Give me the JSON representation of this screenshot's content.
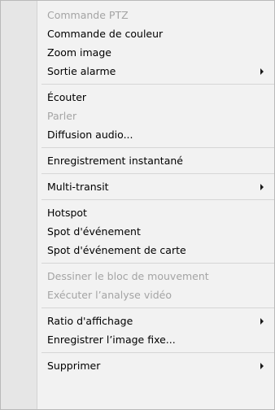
{
  "menu": {
    "items": [
      {
        "type": "item",
        "label": "Commande PTZ",
        "disabled": true,
        "submenu": false
      },
      {
        "type": "item",
        "label": "Commande de couleur",
        "disabled": false,
        "submenu": false
      },
      {
        "type": "item",
        "label": "Zoom image",
        "disabled": false,
        "submenu": false
      },
      {
        "type": "item",
        "label": "Sortie alarme",
        "disabled": false,
        "submenu": true
      },
      {
        "type": "separator"
      },
      {
        "type": "item",
        "label": "Écouter",
        "disabled": false,
        "submenu": false
      },
      {
        "type": "item",
        "label": "Parler",
        "disabled": true,
        "submenu": false
      },
      {
        "type": "item",
        "label": "Diffusion audio...",
        "disabled": false,
        "submenu": false
      },
      {
        "type": "separator"
      },
      {
        "type": "item",
        "label": "Enregistrement instantané",
        "disabled": false,
        "submenu": false
      },
      {
        "type": "separator"
      },
      {
        "type": "item",
        "label": "Multi-transit",
        "disabled": false,
        "submenu": true
      },
      {
        "type": "separator"
      },
      {
        "type": "item",
        "label": "Hotspot",
        "disabled": false,
        "submenu": false
      },
      {
        "type": "item",
        "label": "Spot d'événement",
        "disabled": false,
        "submenu": false
      },
      {
        "type": "item",
        "label": "Spot d'événement de carte",
        "disabled": false,
        "submenu": false
      },
      {
        "type": "separator"
      },
      {
        "type": "item",
        "label": "Dessiner le bloc de mouvement",
        "disabled": true,
        "submenu": false
      },
      {
        "type": "item",
        "label": "Exécuter l’analyse vidéo",
        "disabled": true,
        "submenu": false
      },
      {
        "type": "separator"
      },
      {
        "type": "item",
        "label": "Ratio d'affichage",
        "disabled": false,
        "submenu": true
      },
      {
        "type": "item",
        "label": "Enregistrer l’image fixe...",
        "disabled": false,
        "submenu": false
      },
      {
        "type": "separator"
      },
      {
        "type": "item",
        "label": "Supprimer",
        "disabled": false,
        "submenu": true
      }
    ],
    "colors": {
      "background": "#f2f2f2",
      "gutter": "#e6e6e6",
      "separator": "#d6d6d6",
      "text": "#000000",
      "disabled_text": "#a4a4a4"
    },
    "submenu_icon": "chevron-right-icon"
  }
}
